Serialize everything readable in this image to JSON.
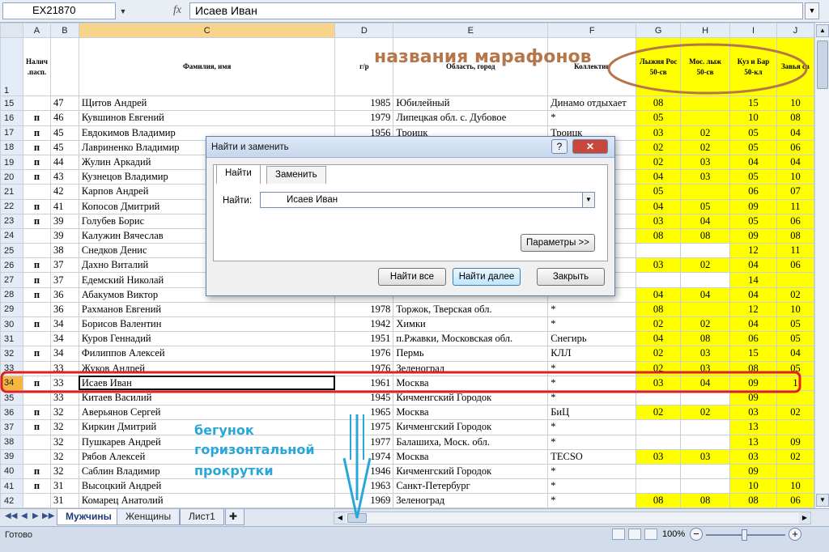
{
  "formula_bar": {
    "name_box": "EX21870",
    "fx": "fx",
    "value": "Исаев Иван"
  },
  "columns": [
    "A",
    "B",
    "C",
    "D",
    "E",
    "F",
    "G",
    "H",
    "I",
    "J"
  ],
  "header_row": {
    "row_num": "1",
    "A": "Налич .пасп.",
    "C": "Фамилия, имя",
    "D": "г/р",
    "E": "Область, город",
    "F": "Коллектив",
    "G": "Лыжня Рос 50-св",
    "H": "Мос. лыж 50-св",
    "I": "Куз и Бар 50-кл",
    "J": "Завья св"
  },
  "rows": [
    {
      "n": "15",
      "a": "",
      "b": "47",
      "name": "Щитов Андрей",
      "year": "1985",
      "city": "Юбилейный",
      "team": "Динамо отдыхает",
      "g": "08",
      "h": "",
      "i": "15",
      "j": "10"
    },
    {
      "n": "16",
      "a": "п",
      "b": "46",
      "name": "Кувшинов Евгений",
      "year": "1979",
      "city": "Липецкая обл. с. Дубовое",
      "team": "*",
      "g": "05",
      "h": "",
      "i": "10",
      "j": "08"
    },
    {
      "n": "17",
      "a": "п",
      "b": "45",
      "name": "Евдокимов Владимир",
      "year": "1956",
      "city": "Троицк",
      "team": "Троицк",
      "g": "03",
      "h": "02",
      "i": "05",
      "j": "04"
    },
    {
      "n": "18",
      "a": "п",
      "b": "45",
      "name": "Лавриненко Владимир",
      "year": "",
      "city": "",
      "team": "",
      "g": "02",
      "h": "02",
      "i": "05",
      "j": "06"
    },
    {
      "n": "19",
      "a": "п",
      "b": "44",
      "name": "Жулин Аркадий",
      "year": "",
      "city": "",
      "team": "",
      "g": "02",
      "h": "03",
      "i": "04",
      "j": "04"
    },
    {
      "n": "20",
      "a": "п",
      "b": "43",
      "name": "Кузнецов Владимир",
      "year": "",
      "city": "",
      "team": "",
      "g": "04",
      "h": "03",
      "i": "05",
      "j": "10"
    },
    {
      "n": "21",
      "a": "",
      "b": "42",
      "name": "Карпов Андрей",
      "year": "",
      "city": "",
      "team": "",
      "g": "05",
      "h": "",
      "i": "06",
      "j": "07"
    },
    {
      "n": "22",
      "a": "п",
      "b": "41",
      "name": "Копосов Дмитрий",
      "year": "",
      "city": "",
      "team": "",
      "g": "04",
      "h": "05",
      "i": "09",
      "j": "11"
    },
    {
      "n": "23",
      "a": "п",
      "b": "39",
      "name": "Голубев Борис",
      "year": "",
      "city": "",
      "team": "",
      "g": "03",
      "h": "04",
      "i": "05",
      "j": "06"
    },
    {
      "n": "24",
      "a": "",
      "b": "39",
      "name": "Калужин Вячеслав",
      "year": "",
      "city": "",
      "team": "",
      "g": "08",
      "h": "08",
      "i": "09",
      "j": "08"
    },
    {
      "n": "25",
      "a": "",
      "b": "38",
      "name": "Снедков Денис",
      "year": "",
      "city": "",
      "team": "хает",
      "g": "",
      "h": "",
      "i": "12",
      "j": "11"
    },
    {
      "n": "26",
      "a": "п",
      "b": "37",
      "name": "Дахно Виталий",
      "year": "",
      "city": "",
      "team": "оком",
      "g": "03",
      "h": "02",
      "i": "04",
      "j": "06"
    },
    {
      "n": "27",
      "a": "п",
      "b": "37",
      "name": "Едемский Николай",
      "year": "",
      "city": "",
      "team": "",
      "g": "",
      "h": "",
      "i": "14",
      "j": ""
    },
    {
      "n": "28",
      "a": "п",
      "b": "36",
      "name": "Абакумов Виктор",
      "year": "",
      "city": "",
      "team": "",
      "g": "04",
      "h": "04",
      "i": "04",
      "j": "02"
    },
    {
      "n": "29",
      "a": "",
      "b": "36",
      "name": "Рахманов Евгений",
      "year": "1978",
      "city": "Торжок, Тверская обл.",
      "team": "*",
      "g": "08",
      "h": "",
      "i": "12",
      "j": "10"
    },
    {
      "n": "30",
      "a": "п",
      "b": "34",
      "name": "Борисов Валентин",
      "year": "1942",
      "city": "Химки",
      "team": "*",
      "g": "02",
      "h": "02",
      "i": "04",
      "j": "05"
    },
    {
      "n": "31",
      "a": "",
      "b": "34",
      "name": "Куров Геннадий",
      "year": "1951",
      "city": "п.Ржавки, Московская обл.",
      "team": "Снегирь",
      "g": "04",
      "h": "08",
      "i": "06",
      "j": "05"
    },
    {
      "n": "32",
      "a": "п",
      "b": "34",
      "name": "Филиппов Алексей",
      "year": "1976",
      "city": "Пермь",
      "team": "КЛЛ",
      "g": "02",
      "h": "03",
      "i": "15",
      "j": "04"
    },
    {
      "n": "33",
      "a": "",
      "b": "33",
      "name": "Жуков Андрей",
      "year": "1976",
      "city": "Зеленоград",
      "team": "*",
      "g": "02",
      "h": "03",
      "i": "08",
      "j": "05"
    },
    {
      "n": "34",
      "a": "п",
      "b": "33",
      "name": "Исаев Иван",
      "year": "1961",
      "city": "Москва",
      "team": "*",
      "g": "03",
      "h": "04",
      "i": "09",
      "j": "1"
    },
    {
      "n": "35",
      "a": "",
      "b": "33",
      "name": "Китаев Василий",
      "year": "1945",
      "city": "Кичменгский Городок",
      "team": "*",
      "g": "",
      "h": "",
      "i": "09",
      "j": ""
    },
    {
      "n": "36",
      "a": "п",
      "b": "32",
      "name": "Аверьянов Сергей",
      "year": "1965",
      "city": "Москва",
      "team": "БиЦ",
      "g": "02",
      "h": "02",
      "i": "03",
      "j": "02"
    },
    {
      "n": "37",
      "a": "п",
      "b": "32",
      "name": "Киркин Дмитрий",
      "year": "1975",
      "city": "Кичменгский Городок",
      "team": "*",
      "g": "",
      "h": "",
      "i": "13",
      "j": ""
    },
    {
      "n": "38",
      "a": "",
      "b": "32",
      "name": "Пушкарев Андрей",
      "year": "1977",
      "city": "Балашиха, Моск. обл.",
      "team": "*",
      "g": "",
      "h": "",
      "i": "13",
      "j": "09"
    },
    {
      "n": "39",
      "a": "",
      "b": "32",
      "name": "Рябов Алексей",
      "year": "1974",
      "city": "Москва",
      "team": "TECSO",
      "g": "03",
      "h": "03",
      "i": "03",
      "j": "02"
    },
    {
      "n": "40",
      "a": "п",
      "b": "32",
      "name": "Саблин Владимир",
      "year": "1946",
      "city": "Кичменгский Городок",
      "team": "*",
      "g": "",
      "h": "",
      "i": "09",
      "j": ""
    },
    {
      "n": "41",
      "a": "п",
      "b": "31",
      "name": "Высоцкий Андрей",
      "year": "1963",
      "city": "Санкт-Петербург",
      "team": "*",
      "g": "",
      "h": "",
      "i": "10",
      "j": "10"
    },
    {
      "n": "42",
      "a": "",
      "b": "31",
      "name": "Комарец Анатолий",
      "year": "1969",
      "city": "Зеленоград",
      "team": "*",
      "g": "08",
      "h": "08",
      "i": "08",
      "j": "06"
    }
  ],
  "yellow_rows_g_h": [
    "15",
    "16",
    "17",
    "18",
    "19",
    "20",
    "21",
    "22",
    "23",
    "24",
    "26",
    "28",
    "29",
    "30",
    "31",
    "32",
    "33",
    "34",
    "36",
    "39",
    "42"
  ],
  "sheet_tabs": [
    "Мужчины",
    "Женщины",
    "Лист1"
  ],
  "active_tab": "Мужчины",
  "status": {
    "ready": "Готово",
    "zoom": "100%"
  },
  "dialog": {
    "title": "Найти и заменить",
    "help": "?",
    "close": "✕",
    "tab_find": "Найти",
    "tab_replace": "Заменить",
    "find_label": "Найти:",
    "find_value": "Исаев Иван",
    "params_button": "Параметры >>",
    "find_all_button": "Найти все",
    "find_next_button": "Найти далее",
    "close_button": "Закрыть"
  },
  "annotations": {
    "marathons": "названия марафонов",
    "slider_line1": "бегунок",
    "slider_line2": "горизонтальной",
    "slider_line3": "прокрутки"
  },
  "colors": {
    "yellow": "#ffff00",
    "annotation_red": "#e02020",
    "annotation_brown": "#b5764a",
    "annotation_blue": "#2aa7d8"
  }
}
